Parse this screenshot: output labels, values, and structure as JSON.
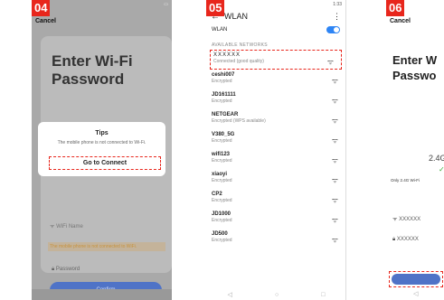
{
  "phone1": {
    "step": "04",
    "cancel": "Cancel",
    "title_line1": "Enter Wi-Fi",
    "title_line2": "Password",
    "wifi_name_faint": "WiFi Name",
    "warning_faint": "The mobile phone is not connected to WiFi.",
    "password_label": "Password",
    "confirm_label": "Confirm",
    "dialog": {
      "title": "Tips",
      "message": "The mobile phone is not connected to Wi-Fi.",
      "button": "Go to Connect"
    }
  },
  "phone2": {
    "step": "05",
    "time": "1:33",
    "title": "WLAN",
    "wlan_label": "WLAN",
    "section_label": "AVAILABLE NETWORKS",
    "networks": [
      {
        "name": "XXXXXX",
        "status": "Connected (good quality)"
      },
      {
        "name": "ceshi007",
        "status": "Encrypted"
      },
      {
        "name": "JD161111",
        "status": "Encrypted"
      },
      {
        "name": "NETGEAR",
        "status": "Encrypted (WPS available)"
      },
      {
        "name": "V380_5G",
        "status": "Encrypted"
      },
      {
        "name": "wifi123",
        "status": "Encrypted"
      },
      {
        "name": "xiaoyi",
        "status": "Encrypted"
      },
      {
        "name": "CP2",
        "status": "Encrypted"
      },
      {
        "name": "JD1000",
        "status": "Encrypted"
      },
      {
        "name": "JD500",
        "status": "Encrypted"
      }
    ]
  },
  "phone3": {
    "step": "06",
    "cancel": "Cancel",
    "title_line1": "Enter W",
    "title_line2": "Passwo",
    "frequency": "2.4G",
    "only_note": "Only 2.4G Wi-Fi",
    "wifi_value": "XXXXXX",
    "password_value": "XXXXXX"
  }
}
